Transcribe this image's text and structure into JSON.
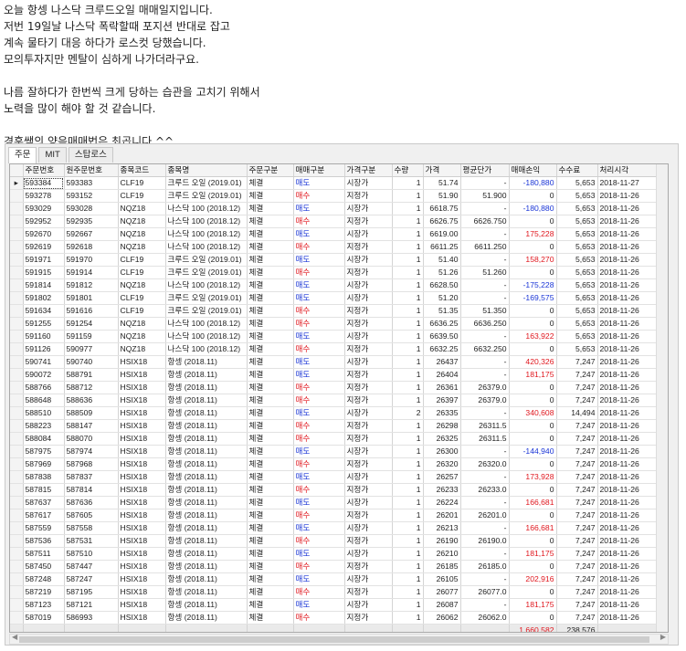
{
  "post": {
    "lines": [
      "오늘 항셍 나스닥 크루드오일 매매일지입니다.",
      "저번 19일날 나스닥 폭락할때 포지션 반대로 잡고",
      "계속 물타기 대응 하다가 로스컷 당했습니다.",
      "모의투자지만 멘탈이 심하게 나가더라구요.",
      "",
      "나름 잘하다가 한번씩 크게 당하는 습관을 고치기 위해서",
      "노력을 많이 해야 할 것 같습니다.",
      "",
      "경훈쌤의 양음매매법은 최곱니다.^^"
    ]
  },
  "tabs": [
    "주문",
    "MIT",
    "스탑로스"
  ],
  "columns": [
    "주문번호",
    "원주문번호",
    "종목코드",
    "종목명",
    "주문구분",
    "매매구분",
    "가격구분",
    "수량",
    "가격",
    "평균단가",
    "매매손익",
    "수수료",
    "처리시각"
  ],
  "colors": {
    "sell": "#1a35d6",
    "buy": "#e0171e"
  },
  "rows": [
    [
      "593384",
      "593383",
      "CLF19",
      "크루드 오일 (2019.01)",
      "체결",
      "매도",
      "시장가",
      "1",
      "51.74",
      "-",
      "-180,880",
      "5,653",
      "2018-11-27"
    ],
    [
      "593278",
      "593152",
      "CLF19",
      "크루드 오일 (2019.01)",
      "체결",
      "매수",
      "지정가",
      "1",
      "51.90",
      "51.900",
      "0",
      "5,653",
      "2018-11-26"
    ],
    [
      "593029",
      "593028",
      "NQZ18",
      "나스닥 100 (2018.12)",
      "체결",
      "매도",
      "시장가",
      "1",
      "6618.75",
      "-",
      "-180,880",
      "5,653",
      "2018-11-26"
    ],
    [
      "592952",
      "592935",
      "NQZ18",
      "나스닥 100 (2018.12)",
      "체결",
      "매수",
      "지정가",
      "1",
      "6626.75",
      "6626.750",
      "0",
      "5,653",
      "2018-11-26"
    ],
    [
      "592670",
      "592667",
      "NQZ18",
      "나스닥 100 (2018.12)",
      "체결",
      "매도",
      "시장가",
      "1",
      "6619.00",
      "-",
      "175,228",
      "5,653",
      "2018-11-26"
    ],
    [
      "592619",
      "592618",
      "NQZ18",
      "나스닥 100 (2018.12)",
      "체결",
      "매수",
      "지정가",
      "1",
      "6611.25",
      "6611.250",
      "0",
      "5,653",
      "2018-11-26"
    ],
    [
      "591971",
      "591970",
      "CLF19",
      "크루드 오일 (2019.01)",
      "체결",
      "매도",
      "시장가",
      "1",
      "51.40",
      "-",
      "158,270",
      "5,653",
      "2018-11-26"
    ],
    [
      "591915",
      "591914",
      "CLF19",
      "크루드 오일 (2019.01)",
      "체결",
      "매수",
      "지정가",
      "1",
      "51.26",
      "51.260",
      "0",
      "5,653",
      "2018-11-26"
    ],
    [
      "591814",
      "591812",
      "NQZ18",
      "나스닥 100 (2018.12)",
      "체결",
      "매도",
      "시장가",
      "1",
      "6628.50",
      "-",
      "-175,228",
      "5,653",
      "2018-11-26"
    ],
    [
      "591802",
      "591801",
      "CLF19",
      "크루드 오일 (2019.01)",
      "체결",
      "매도",
      "시장가",
      "1",
      "51.20",
      "-",
      "-169,575",
      "5,653",
      "2018-11-26"
    ],
    [
      "591634",
      "591616",
      "CLF19",
      "크루드 오일 (2019.01)",
      "체결",
      "매수",
      "지정가",
      "1",
      "51.35",
      "51.350",
      "0",
      "5,653",
      "2018-11-26"
    ],
    [
      "591255",
      "591254",
      "NQZ18",
      "나스닥 100 (2018.12)",
      "체결",
      "매수",
      "지정가",
      "1",
      "6636.25",
      "6636.250",
      "0",
      "5,653",
      "2018-11-26"
    ],
    [
      "591160",
      "591159",
      "NQZ18",
      "나스닥 100 (2018.12)",
      "체결",
      "매도",
      "시장가",
      "1",
      "6639.50",
      "-",
      "163,922",
      "5,653",
      "2018-11-26"
    ],
    [
      "591126",
      "590977",
      "NQZ18",
      "나스닥 100 (2018.12)",
      "체결",
      "매수",
      "지정가",
      "1",
      "6632.25",
      "6632.250",
      "0",
      "5,653",
      "2018-11-26"
    ],
    [
      "590741",
      "590740",
      "HSIX18",
      "항셍 (2018.11)",
      "체결",
      "매도",
      "시장가",
      "1",
      "26437",
      "-",
      "420,326",
      "7,247",
      "2018-11-26"
    ],
    [
      "590072",
      "588791",
      "HSIX18",
      "항셍 (2018.11)",
      "체결",
      "매도",
      "지정가",
      "1",
      "26404",
      "-",
      "181,175",
      "7,247",
      "2018-11-26"
    ],
    [
      "588766",
      "588712",
      "HSIX18",
      "항셍 (2018.11)",
      "체결",
      "매수",
      "지정가",
      "1",
      "26361",
      "26379.0",
      "0",
      "7,247",
      "2018-11-26"
    ],
    [
      "588648",
      "588636",
      "HSIX18",
      "항셍 (2018.11)",
      "체결",
      "매수",
      "지정가",
      "1",
      "26397",
      "26379.0",
      "0",
      "7,247",
      "2018-11-26"
    ],
    [
      "588510",
      "588509",
      "HSIX18",
      "항셍 (2018.11)",
      "체결",
      "매도",
      "시장가",
      "2",
      "26335",
      "-",
      "340,608",
      "14,494",
      "2018-11-26"
    ],
    [
      "588223",
      "588147",
      "HSIX18",
      "항셍 (2018.11)",
      "체결",
      "매수",
      "지정가",
      "1",
      "26298",
      "26311.5",
      "0",
      "7,247",
      "2018-11-26"
    ],
    [
      "588084",
      "588070",
      "HSIX18",
      "항셍 (2018.11)",
      "체결",
      "매수",
      "지정가",
      "1",
      "26325",
      "26311.5",
      "0",
      "7,247",
      "2018-11-26"
    ],
    [
      "587975",
      "587974",
      "HSIX18",
      "항셍 (2018.11)",
      "체결",
      "매도",
      "시장가",
      "1",
      "26300",
      "-",
      "-144,940",
      "7,247",
      "2018-11-26"
    ],
    [
      "587969",
      "587968",
      "HSIX18",
      "항셍 (2018.11)",
      "체결",
      "매수",
      "지정가",
      "1",
      "26320",
      "26320.0",
      "0",
      "7,247",
      "2018-11-26"
    ],
    [
      "587838",
      "587837",
      "HSIX18",
      "항셍 (2018.11)",
      "체결",
      "매도",
      "시장가",
      "1",
      "26257",
      "-",
      "173,928",
      "7,247",
      "2018-11-26"
    ],
    [
      "587815",
      "587814",
      "HSIX18",
      "항셍 (2018.11)",
      "체결",
      "매수",
      "지정가",
      "1",
      "26233",
      "26233.0",
      "0",
      "7,247",
      "2018-11-26"
    ],
    [
      "587637",
      "587636",
      "HSIX18",
      "항셍 (2018.11)",
      "체결",
      "매도",
      "시장가",
      "1",
      "26224",
      "-",
      "166,681",
      "7,247",
      "2018-11-26"
    ],
    [
      "587617",
      "587605",
      "HSIX18",
      "항셍 (2018.11)",
      "체결",
      "매수",
      "지정가",
      "1",
      "26201",
      "26201.0",
      "0",
      "7,247",
      "2018-11-26"
    ],
    [
      "587559",
      "587558",
      "HSIX18",
      "항셍 (2018.11)",
      "체결",
      "매도",
      "시장가",
      "1",
      "26213",
      "-",
      "166,681",
      "7,247",
      "2018-11-26"
    ],
    [
      "587536",
      "587531",
      "HSIX18",
      "항셍 (2018.11)",
      "체결",
      "매수",
      "지정가",
      "1",
      "26190",
      "26190.0",
      "0",
      "7,247",
      "2018-11-26"
    ],
    [
      "587511",
      "587510",
      "HSIX18",
      "항셍 (2018.11)",
      "체결",
      "매도",
      "시장가",
      "1",
      "26210",
      "-",
      "181,175",
      "7,247",
      "2018-11-26"
    ],
    [
      "587450",
      "587447",
      "HSIX18",
      "항셍 (2018.11)",
      "체결",
      "매수",
      "지정가",
      "1",
      "26185",
      "26185.0",
      "0",
      "7,247",
      "2018-11-26"
    ],
    [
      "587248",
      "587247",
      "HSIX18",
      "항셍 (2018.11)",
      "체결",
      "매도",
      "시장가",
      "1",
      "26105",
      "-",
      "202,916",
      "7,247",
      "2018-11-26"
    ],
    [
      "587219",
      "587195",
      "HSIX18",
      "항셍 (2018.11)",
      "체결",
      "매수",
      "지정가",
      "1",
      "26077",
      "26077.0",
      "0",
      "7,247",
      "2018-11-26"
    ],
    [
      "587123",
      "587121",
      "HSIX18",
      "항셍 (2018.11)",
      "체결",
      "매도",
      "시장가",
      "1",
      "26087",
      "-",
      "181,175",
      "7,247",
      "2018-11-26"
    ],
    [
      "587019",
      "586993",
      "HSIX18",
      "항셍 (2018.11)",
      "체결",
      "매수",
      "지정가",
      "1",
      "26062",
      "26062.0",
      "0",
      "7,247",
      "2018-11-26"
    ]
  ],
  "totals": {
    "pnl": "1,660,582",
    "fee": "238,576"
  }
}
